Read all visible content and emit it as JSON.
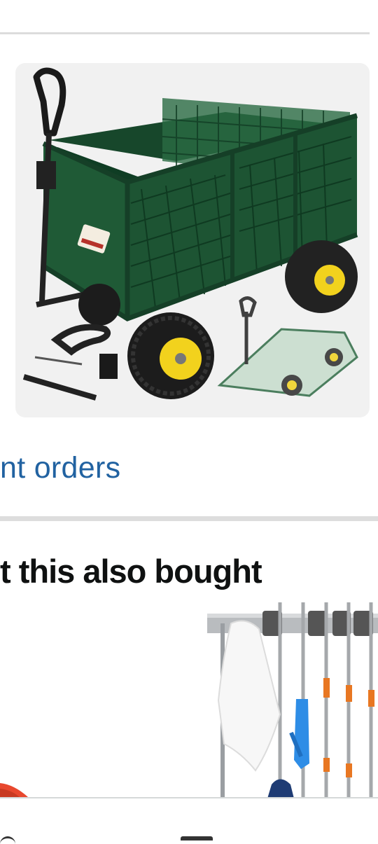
{
  "product": {
    "image_alt": "Green garden utility cart with mesh sides, yellow-hub wheels, handle and assembly parts"
  },
  "links": {
    "orders_text": "nt orders"
  },
  "recommendations": {
    "title": "t this also bought"
  },
  "colors": {
    "link": "#2162a1",
    "cart_green": "#1d5433",
    "wheel_hub": "#f2d21d",
    "card_bg": "#f1f1f1"
  },
  "icons": {
    "nav_left": "home-icon",
    "nav_center": "menu-icon"
  }
}
